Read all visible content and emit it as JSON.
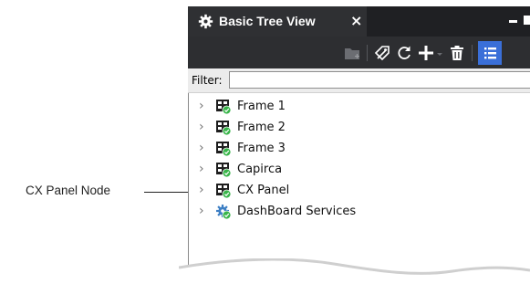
{
  "callout": {
    "label": "CX Panel Node"
  },
  "tab": {
    "title": "Basic Tree View",
    "close_glyph": "×",
    "icon": "gear-icon"
  },
  "window_controls": {
    "minimize_icon": "minimize-icon",
    "maximize_icon": "maximize-icon"
  },
  "toolbar": {
    "icons": [
      "new-folder-icon",
      "tag-edit-icon",
      "refresh-icon",
      "add-icon",
      "delete-icon",
      "list-view-icon"
    ]
  },
  "filter": {
    "label": "Filter:",
    "value": "",
    "placeholder": ""
  },
  "tree": {
    "items": [
      {
        "label": "Frame 1",
        "icon": "panel-node-icon"
      },
      {
        "label": "Frame 2",
        "icon": "panel-node-icon"
      },
      {
        "label": "Frame 3",
        "icon": "panel-node-icon"
      },
      {
        "label": "Capirca",
        "icon": "panel-node-icon"
      },
      {
        "label": "CX Panel",
        "icon": "panel-node-icon"
      },
      {
        "label": "DashBoard Services",
        "icon": "services-icon"
      }
    ],
    "expander_glyph": "›"
  },
  "colors": {
    "tab_background": "#2f3033",
    "titlebar_background": "#1f2023",
    "toolbar_background": "#2d2e31",
    "filter_background": "#ececec",
    "status_green": "#39b54a",
    "toolbar_active_blue": "#3a6fd8"
  }
}
